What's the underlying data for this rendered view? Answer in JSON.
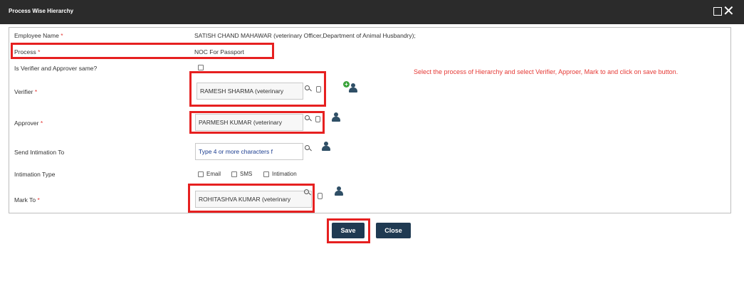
{
  "dialog": {
    "title": "Process Wise Hierarchy",
    "close_glyph": "✕"
  },
  "form": {
    "employee_name": {
      "label": "Employee Name",
      "required": "*",
      "value": "SATISH CHAND MAHAWAR (veterinary Officer,Department of Animal Husbandry);"
    },
    "process": {
      "label": "Process",
      "required": "*",
      "value": "NOC For Passport"
    },
    "verifier_approver_same": {
      "label": "Is Verifier and Approver same?",
      "checked": false
    },
    "verifier": {
      "label": "Verifier",
      "required": "*",
      "value": "RAMESH  SHARMA (veterinary"
    },
    "approver": {
      "label": "Approver",
      "required": "*",
      "value": "PARMESH  KUMAR (veterinary"
    },
    "send_intimation_to": {
      "label": "Send Intimation To",
      "placeholder": "Type 4 or more characters f"
    },
    "intimation_type": {
      "label": "Intimation Type",
      "options": [
        {
          "label": "Email",
          "checked": false
        },
        {
          "label": "SMS",
          "checked": false
        },
        {
          "label": "Intimation",
          "checked": false
        }
      ]
    },
    "mark_to": {
      "label": "Mark To",
      "required": "*",
      "value": "ROHITASHVA  KUMAR (veterinary"
    }
  },
  "hint": "Select the process of Hierarchy and select Verifier, Approer, Mark to and click on save button.",
  "buttons": {
    "save": "Save",
    "close": "Close"
  },
  "colors": {
    "annotation_red": "#e62020",
    "button_navy": "#1f3a52",
    "title_bar": "#2b2b2b"
  },
  "icons": [
    "search-icon",
    "clear-icon",
    "add-icon",
    "user-lookup-icon",
    "maximize-icon",
    "close-icon"
  ]
}
